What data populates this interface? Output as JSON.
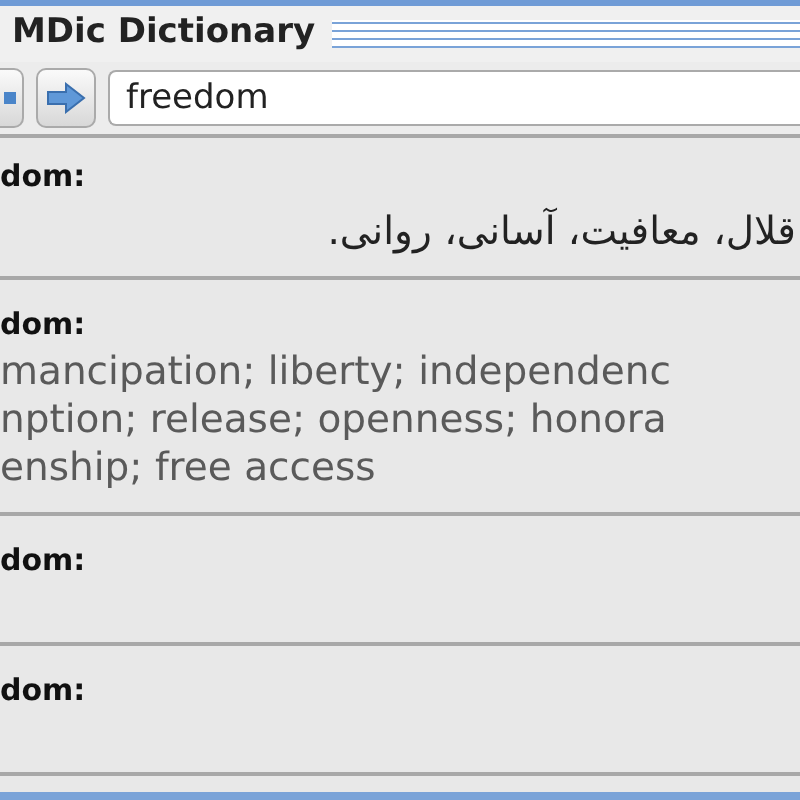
{
  "window": {
    "title": "MDic Dictionary"
  },
  "search": {
    "value": "freedom"
  },
  "results": [
    {
      "heading": "dom:",
      "kind": "rtl",
      "lines": [
        "قلال، معافیت، آسانی، روانی."
      ]
    },
    {
      "heading": "dom:",
      "kind": "ltr",
      "lines": [
        "mancipation; liberty; independenc",
        "nption; release; openness; honora",
        "enship; free access"
      ]
    },
    {
      "heading": "dom:"
    },
    {
      "heading": "dom:"
    }
  ]
}
